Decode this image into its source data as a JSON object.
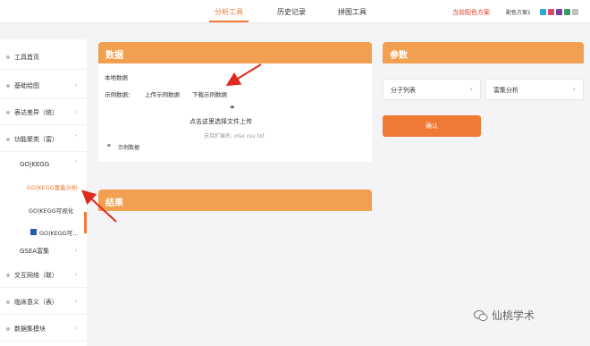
{
  "topbar": {
    "tabs": [
      {
        "label": "分析工具",
        "active": true
      },
      {
        "label": "历史记录",
        "active": false
      },
      {
        "label": "拼图工具",
        "active": false
      }
    ],
    "current_scheme": "当前配色方案",
    "scheme_label": "配色方案1",
    "swatch_colors": [
      "#2fa7d8",
      "#d94a6a",
      "#7a3fa0",
      "#3a9a6a",
      "#c0c0c0"
    ],
    "accent": "#ee7a35"
  },
  "sidebar": {
    "items": [
      {
        "label": "工具首页"
      },
      {
        "label": "基础绘图"
      },
      {
        "label": "表达差异（统）"
      },
      {
        "label": "功能聚类（富）"
      },
      {
        "label": "交互网络（联）"
      },
      {
        "label": "临床意义（表）"
      },
      {
        "label": "数据集模块"
      }
    ],
    "sub_group": "GO|KEGG",
    "sub_items": [
      {
        "label": "GO|KEGG富集分析",
        "active": true
      },
      {
        "label": "GO|KEGG可视化",
        "active": false
      },
      {
        "label": "GO|KEGG可...",
        "active": false
      }
    ],
    "gsea": "GSEA富集"
  },
  "data_panel": {
    "title": "数据",
    "local_data": "本地数据",
    "example_label": "示例数据：",
    "upload_example": "上传示例数据",
    "download_example": "下载示例数据",
    "upload_hint": "点击这里选择文件上传",
    "extensions": "支持扩展名: xlsx csv txt",
    "example_link": "示例数据"
  },
  "result_panel": {
    "title": "结果"
  },
  "param_panel": {
    "title": "参数",
    "molecule_list": "分子列表",
    "enrichment": "富集分析",
    "confirm": "确认"
  },
  "watermark": "仙桃学术"
}
